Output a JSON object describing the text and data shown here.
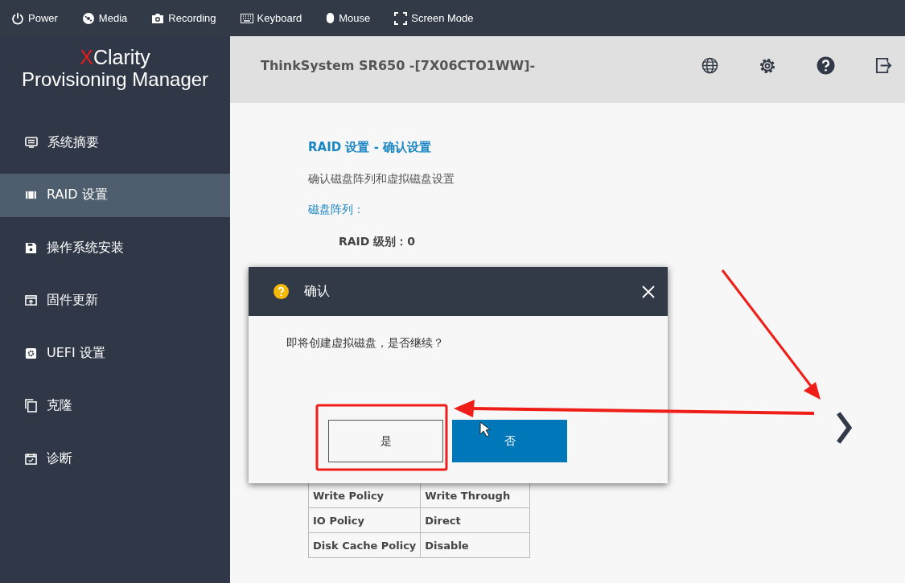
{
  "toolbar": [
    {
      "kind": "power",
      "label": "Power"
    },
    {
      "kind": "media",
      "label": "Media"
    },
    {
      "kind": "recording",
      "label": "Recording"
    },
    {
      "kind": "keyboard",
      "label": "Keyboard"
    },
    {
      "kind": "mouse",
      "label": "Mouse"
    },
    {
      "kind": "screen",
      "label": "Screen Mode"
    }
  ],
  "logo": {
    "mark": "X",
    "word": "Clarity",
    "product": "Provisioning Manager"
  },
  "sidebar": {
    "items": [
      {
        "kind": "summary",
        "label": "系统摘要",
        "selected": false
      },
      {
        "kind": "raid",
        "label": "RAID 设置",
        "selected": true
      },
      {
        "kind": "os",
        "label": "操作系统安装",
        "selected": false
      },
      {
        "kind": "firmware",
        "label": "固件更新",
        "selected": false
      },
      {
        "kind": "uefi",
        "label": "UEFI 设置",
        "selected": false
      },
      {
        "kind": "clone",
        "label": "克隆",
        "selected": false
      },
      {
        "kind": "diag",
        "label": "诊断",
        "selected": false
      }
    ]
  },
  "header": {
    "title": "ThinkSystem SR650 -[7X06CTO1WW]-",
    "buttons": [
      {
        "kind": "globe"
      },
      {
        "kind": "settings"
      },
      {
        "kind": "help"
      },
      {
        "kind": "exit"
      }
    ]
  },
  "content": {
    "title": "RAID 设置 - 确认设置",
    "subtitle": "确认磁盘阵列和虚拟磁盘设置",
    "section": "磁盘阵列：",
    "raid_level": "RAID 级别：0",
    "table": {
      "rows": [
        [
          "Write Policy",
          "Write Through"
        ],
        [
          "IO Policy",
          "Direct"
        ],
        [
          "Disk Cache Policy",
          "Disable"
        ]
      ]
    }
  },
  "dialog": {
    "title": "确认",
    "message": "即将创建虚拟磁盘，是否继续？",
    "buttons": [
      {
        "kind": "secondary",
        "label": "是"
      },
      {
        "kind": "primary",
        "label": "否"
      }
    ]
  }
}
